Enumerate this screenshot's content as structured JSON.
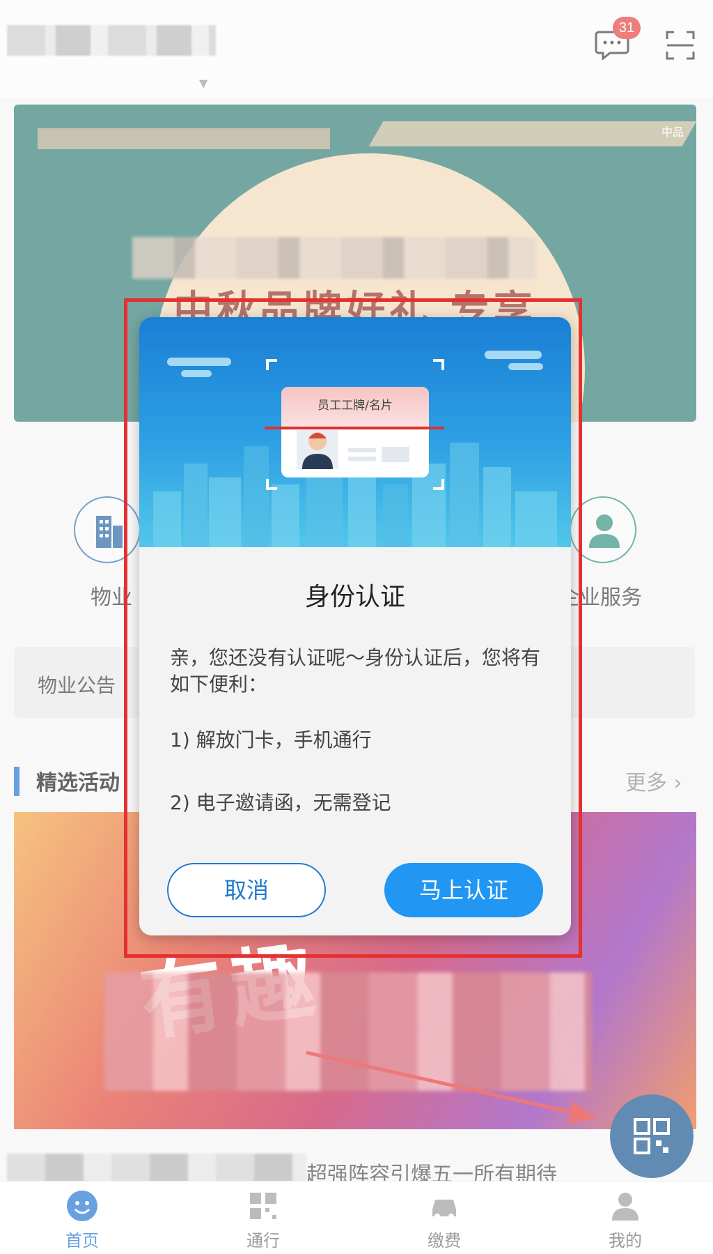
{
  "header": {
    "message_badge": "31"
  },
  "banner": {
    "tag": "中品",
    "headline": "中秋品牌好礼 专享"
  },
  "categories": [
    {
      "label": "物业"
    },
    {
      "label": "企业服务"
    }
  ],
  "notice": {
    "label": "物业公告"
  },
  "section": {
    "title": "精选活动",
    "more": "更多 ›"
  },
  "promo": {
    "headline": "有趣"
  },
  "caption": {
    "text": "超强阵容引爆五一所有期待"
  },
  "tabs": [
    {
      "label": "首页",
      "active": true
    },
    {
      "label": "通行",
      "active": false
    },
    {
      "label": "缴费",
      "active": false
    },
    {
      "label": "我的",
      "active": false
    }
  ],
  "dialog": {
    "card_title": "员工工牌/名片",
    "title": "身份认证",
    "intro": "亲，您还没有认证呢～身份认证后，您将有如下便利：",
    "item1": "1) 解放门卡，手机通行",
    "item2": "2) 电子邀请函，无需登记",
    "cancel_label": "取消",
    "confirm_label": "马上认证"
  },
  "colors": {
    "accent": "#2196f3",
    "highlight_frame": "#e53030",
    "badge": "#e53935"
  }
}
